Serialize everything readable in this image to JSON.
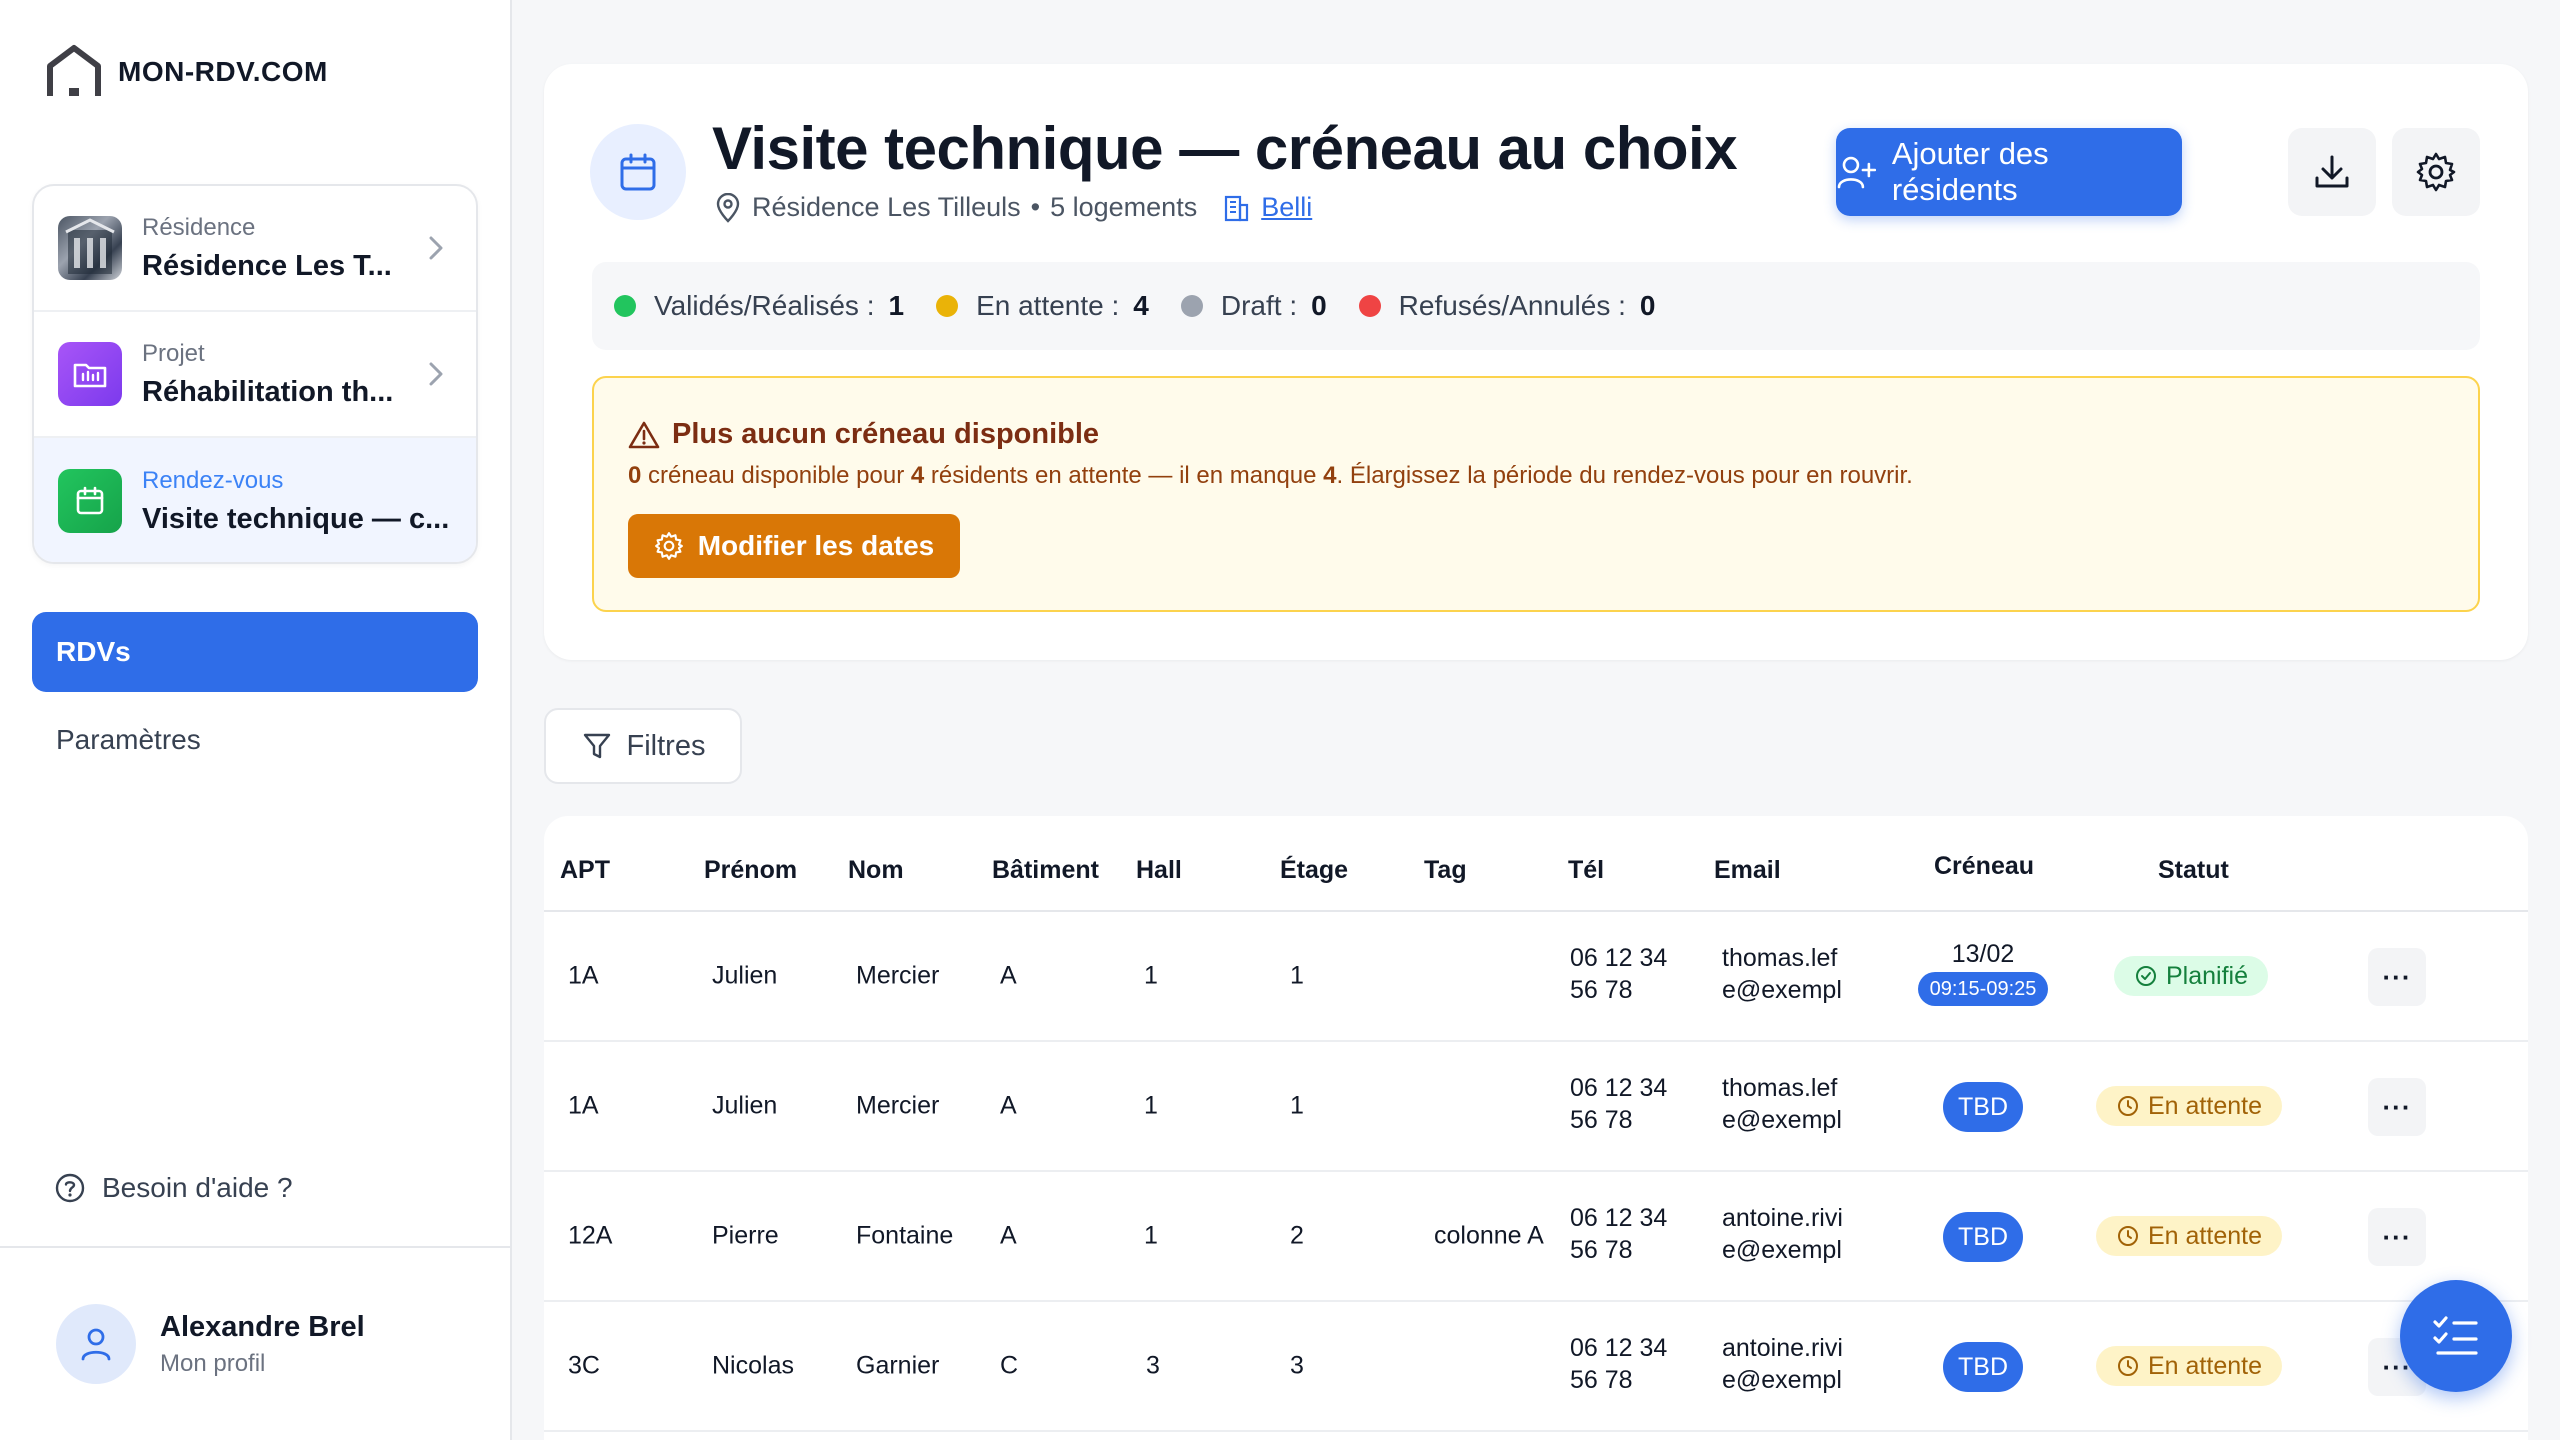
{
  "brand": {
    "name": "MON-RDV.COM"
  },
  "context": {
    "residence": {
      "label": "Résidence",
      "value": "Résidence Les T..."
    },
    "projet": {
      "label": "Projet",
      "value": "Réhabilitation th..."
    },
    "rdv": {
      "label": "Rendez-vous",
      "value": "Visite technique — c..."
    }
  },
  "nav": {
    "rdvs": "RDVs",
    "parametres": "Paramètres"
  },
  "help": "Besoin d'aide ?",
  "profile": {
    "name": "Alexandre Brel",
    "sub": "Mon profil"
  },
  "header": {
    "title": "Visite technique — créneau au choix",
    "residence": "Résidence Les Tilleuls",
    "logements": "5 logements",
    "company": "Belli",
    "add_button": "Ajouter des résidents"
  },
  "stats": [
    {
      "label": "Validés/Réalisés :",
      "value": "1",
      "color": "#22c55e"
    },
    {
      "label": "En attente :",
      "value": "4",
      "color": "#eab308"
    },
    {
      "label": "Draft :",
      "value": "0",
      "color": "#9ca3af"
    },
    {
      "label": "Refusés/Annulés :",
      "value": "0",
      "color": "#ef4444"
    }
  ],
  "warning": {
    "title": "Plus aucun créneau disponible",
    "n_slots": "0",
    "t1": " créneau disponible pour ",
    "n_pending": "4",
    "t2": " résidents en attente — il en manque ",
    "n_missing": "4",
    "t3": ". Élargissez la période du rendez-vous pour en rouvrir.",
    "button": "Modifier les dates"
  },
  "filters": "Filtres",
  "table": {
    "columns": [
      "APT",
      "Prénom",
      "Nom",
      "Bâtiment",
      "Hall",
      "Étage",
      "Tag",
      "Tél",
      "Email",
      "Créneau",
      "Statut"
    ],
    "rows": [
      {
        "apt": "1A",
        "prenom": "Julien",
        "nom": "Mercier",
        "batiment": "A",
        "hall": "1",
        "etage": "1",
        "tag": "",
        "tel1": "06 12 34",
        "tel2": "56 78",
        "email1": "thomas.lef",
        "email2": "e@exempl",
        "date": "13/02",
        "slot": "09:15-09:25",
        "statut": "Planifié"
      },
      {
        "apt": "1A",
        "prenom": "Julien",
        "nom": "Mercier",
        "batiment": "A",
        "hall": "1",
        "etage": "1",
        "tag": "",
        "tel1": "06 12 34",
        "tel2": "56 78",
        "email1": "thomas.lef",
        "email2": "e@exempl",
        "slot": "TBD",
        "statut": "En attente"
      },
      {
        "apt": "12A",
        "prenom": "Pierre",
        "nom": "Fontaine",
        "batiment": "A",
        "hall": "1",
        "etage": "2",
        "tag": "colonne A",
        "tel1": "06 12 34",
        "tel2": "56 78",
        "email1": "antoine.rivi",
        "email2": "e@exempl",
        "slot": "TBD",
        "statut": "En attente"
      },
      {
        "apt": "3C",
        "prenom": "Nicolas",
        "nom": "Garnier",
        "batiment": "C",
        "hall": "3",
        "etage": "3",
        "tag": "",
        "tel1": "06 12 34",
        "tel2": "56 78",
        "email1": "antoine.rivi",
        "email2": "e@exempl",
        "slot": "TBD",
        "statut": "En attente"
      }
    ],
    "more": "···"
  }
}
